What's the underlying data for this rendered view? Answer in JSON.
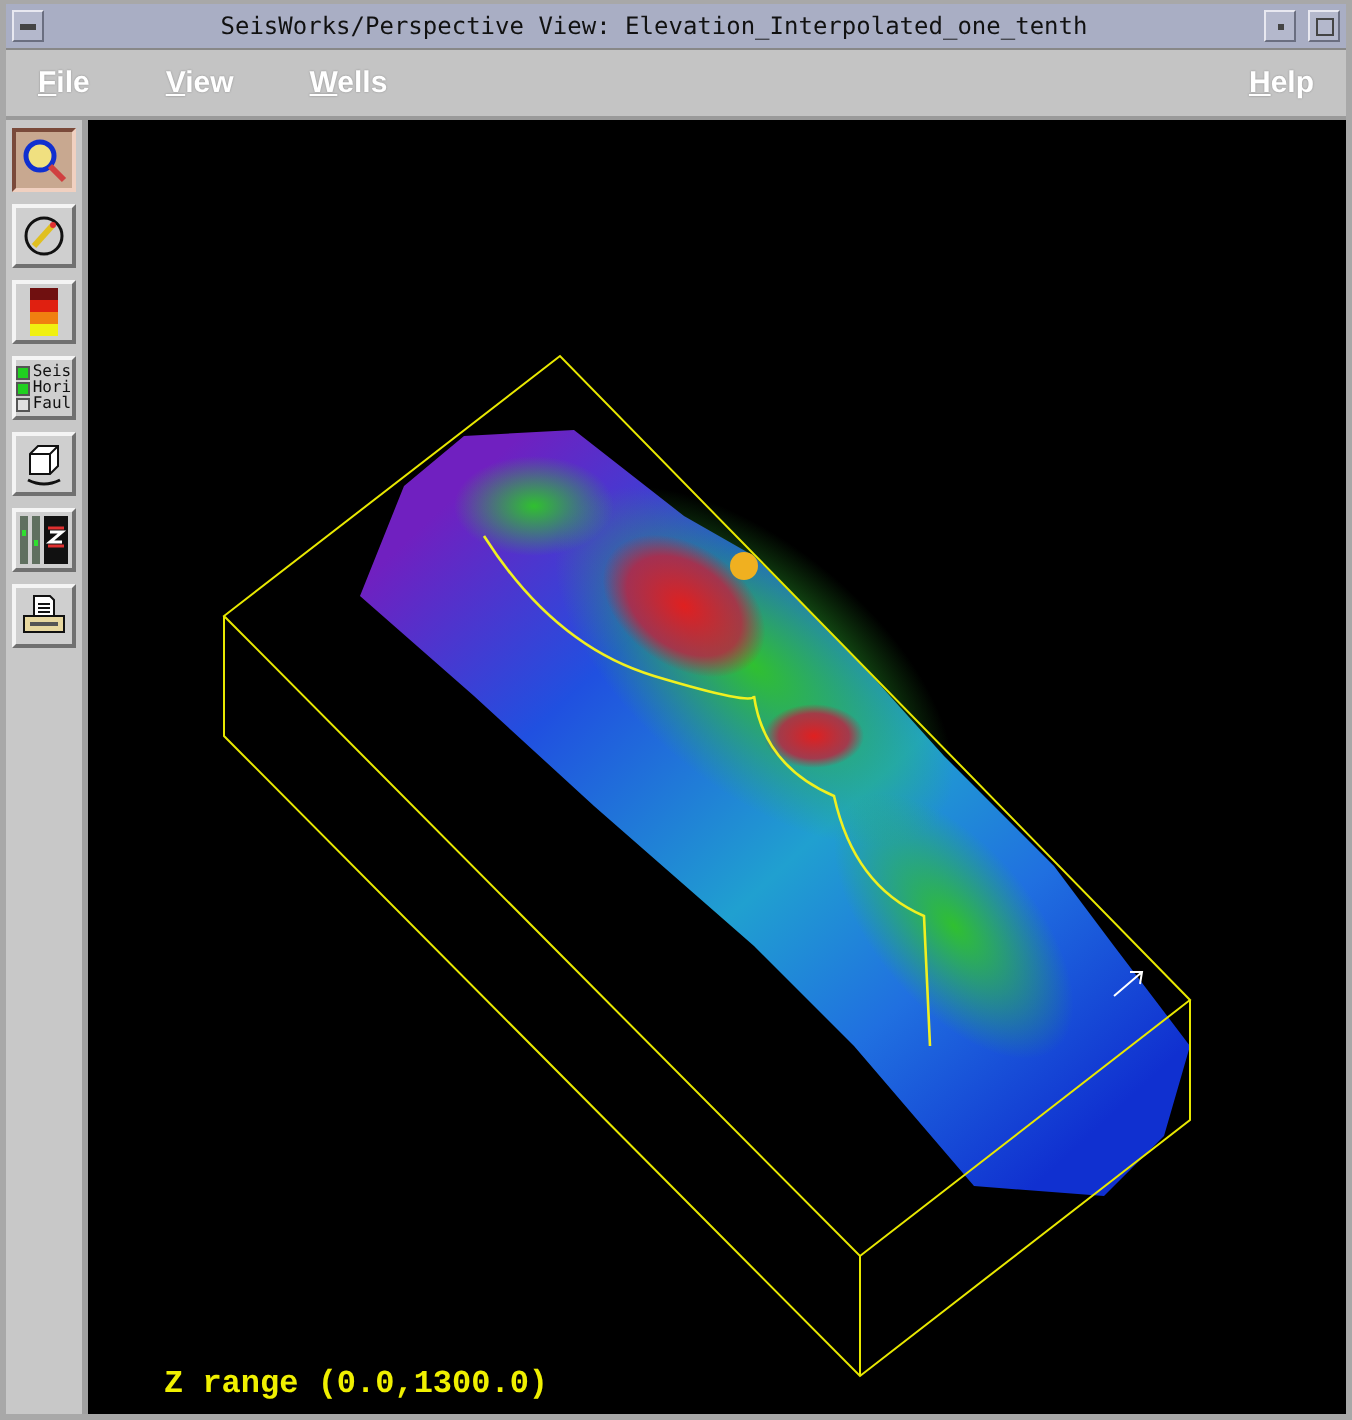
{
  "window": {
    "title": "SeisWorks/Perspective View: Elevation_Interpolated_one_tenth"
  },
  "menu": [
    {
      "label": "File"
    },
    {
      "label": "View"
    },
    {
      "label": "Wells"
    }
  ],
  "help": {
    "label": "Help"
  },
  "toolbar": [
    {
      "kind": "zoom",
      "selected": true
    },
    {
      "kind": "pencil",
      "selected": false
    },
    {
      "kind": "colorbar",
      "selected": false
    },
    {
      "kind": "layers",
      "selected": false,
      "items": [
        {
          "label": "Seis",
          "checked": true
        },
        {
          "label": "Hori",
          "checked": true
        },
        {
          "label": "Faul",
          "checked": false
        }
      ]
    },
    {
      "kind": "cube",
      "selected": false
    },
    {
      "kind": "zscale",
      "selected": false
    },
    {
      "kind": "printer",
      "selected": false
    }
  ],
  "viewport": {
    "z_range": "Z range (0.0,1300.0)"
  }
}
